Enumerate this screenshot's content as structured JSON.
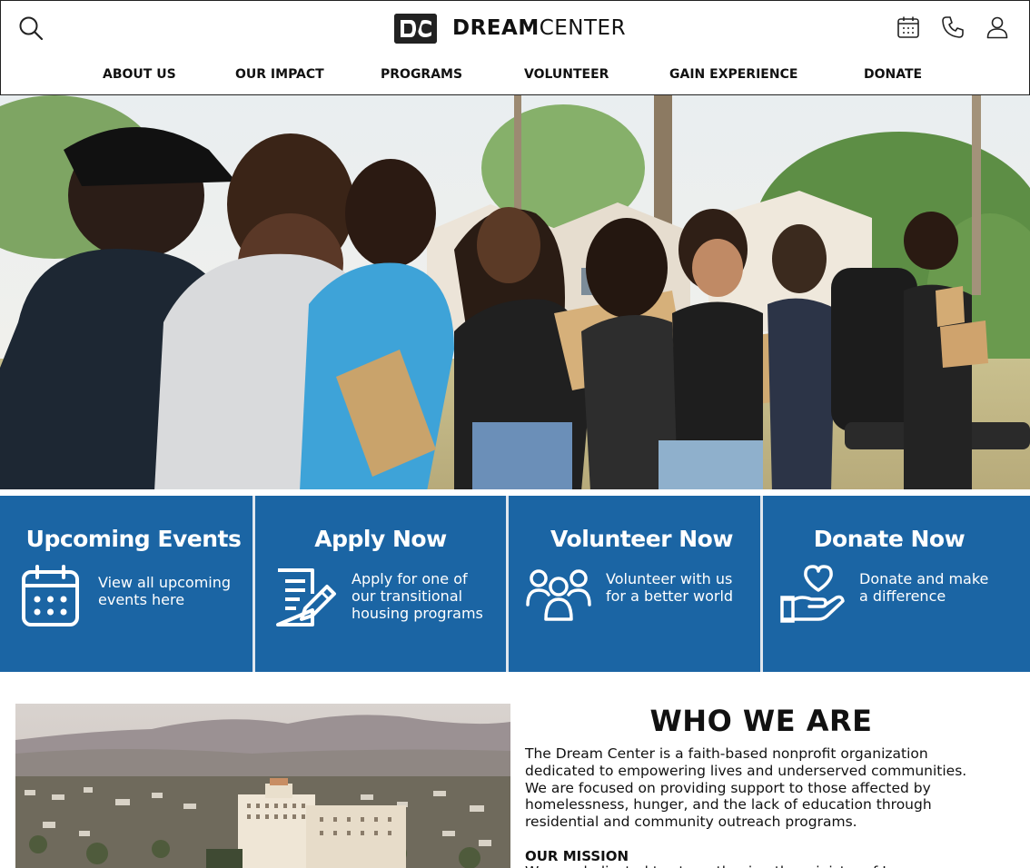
{
  "header": {
    "logo_mark": "DC",
    "logo_text_bold": "DREAM",
    "logo_text_rest": "CENTER",
    "icons": [
      "search-icon",
      "calendar-icon",
      "phone-icon",
      "user-icon"
    ]
  },
  "nav": {
    "items": [
      "ABOUT US",
      "OUR IMPACT",
      "PROGRAMS",
      "VOLUNTEER",
      "GAIN EXPERIENCE",
      "DONATE"
    ]
  },
  "hero": {
    "description_icon": "volunteers-photo"
  },
  "cards": [
    {
      "title": "Upcoming Events",
      "text": [
        "View all upcoming",
        "events here"
      ],
      "icon": "calendar-icon"
    },
    {
      "title": "Apply Now",
      "text": [
        "Apply for one of",
        "our transitional",
        "housing programs"
      ],
      "icon": "document-pen-icon"
    },
    {
      "title": "Volunteer Now",
      "text": [
        "Volunteer with us",
        "for a better world"
      ],
      "icon": "people-icon"
    },
    {
      "title": "Donate Now",
      "text": [
        "Donate and make",
        "a difference"
      ],
      "icon": "heart-hand-icon"
    }
  ],
  "about": {
    "title": "WHO WE ARE",
    "body": [
      "The Dream Center is a faith-based nonprofit organization",
      "dedicated to empowering lives and underserved communities.",
      "We are focused on providing support to those affected by",
      "homelessness, hunger, and the lack of education through",
      "residential and community outreach programs."
    ],
    "mission_title": "OUR MISSION",
    "mission_body": "We are dedicated to strengthening the ministry of Jesus"
  },
  "colors": {
    "card_blue": "#1b65a4",
    "card_gap": "#dfe6ee",
    "text": "#111111"
  }
}
